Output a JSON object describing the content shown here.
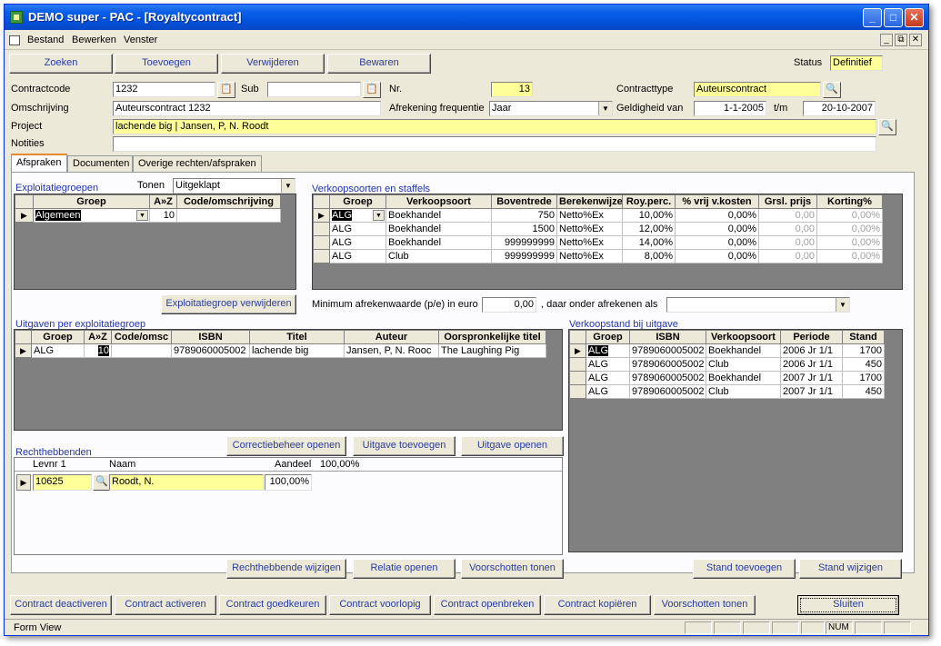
{
  "window": {
    "title": "DEMO super - PAC - [Royaltycontract]",
    "min": "_",
    "max": "□",
    "close": "✕"
  },
  "menu": {
    "items": [
      "Bestand",
      "Bewerken",
      "Venster"
    ],
    "mdi_min": "_",
    "mdi_restore": "⧉",
    "mdi_close": "✕"
  },
  "toolbar": {
    "buttons": [
      "Zoeken",
      "Toevoegen",
      "Verwijderen",
      "Bewaren"
    ],
    "status_label": "Status",
    "status_value": "Definitief"
  },
  "form": {
    "contractcode_label": "Contractcode",
    "contractcode_value": "1232",
    "sub_label": "Sub",
    "sub_value": "",
    "nr_label": "Nr.",
    "nr_value": "13",
    "contracttype_label": "Contracttype",
    "contracttype_value": "Auteurscontract",
    "omschrijving_label": "Omschrijving",
    "omschrijving_value": "Auteurscontract 1232",
    "afrekening_label": "Afrekening frequentie",
    "afrekening_value": "Jaar",
    "geldigheid_label": "Geldigheid van",
    "geldigheid_van": "1-1-2005",
    "tm_label": "t/m",
    "geldigheid_tm": "20-10-2007",
    "project_label": "Project",
    "project_value": "lachende big | Jansen, P, N. Roodt",
    "notities_label": "Notities",
    "notities_value": ""
  },
  "tabs": [
    "Afspraken",
    "Documenten",
    "Overige rechten/afspraken"
  ],
  "exploitatie": {
    "title": "Exploitatiegroepen",
    "tonen_label": "Tonen",
    "tonen_value": "Uitgeklapt",
    "columns": [
      "Groep",
      "A»Z",
      "Code/omschrijving"
    ],
    "rows": [
      [
        "Algemeen",
        "10",
        ""
      ]
    ],
    "remove_button": "Exploitatiegroep verwijderen"
  },
  "verkoop": {
    "title": "Verkoopsoorten en staffels",
    "columns": [
      "Groep",
      "Verkoopsoort",
      "Boventrede",
      "Berekenwijze",
      "Roy.perc.",
      "% vrij v.kosten",
      "Grsl. prijs",
      "Korting%"
    ],
    "rows": [
      [
        "ALG",
        "Boekhandel",
        "750",
        "Netto%Ex",
        "10,00%",
        "0,00%",
        "0,00",
        "0,00%"
      ],
      [
        "ALG",
        "Boekhandel",
        "1500",
        "Netto%Ex",
        "12,00%",
        "0,00%",
        "0,00",
        "0,00%"
      ],
      [
        "ALG",
        "Boekhandel",
        "999999999",
        "Netto%Ex",
        "14,00%",
        "0,00%",
        "0,00",
        "0,00%"
      ],
      [
        "ALG",
        "Club",
        "999999999",
        "Netto%Ex",
        "8,00%",
        "0,00%",
        "0,00",
        "0,00%"
      ]
    ],
    "min_label": "Minimum afrekenwaarde (p/e) in euro",
    "min_value": "0,00",
    "daar_label": ", daar onder afrekenen als",
    "daar_value": ""
  },
  "uitgaven": {
    "title": "Uitgaven per exploitatiegroep",
    "columns": [
      "Groep",
      "A»Z",
      "Code/omsc",
      "ISBN",
      "Titel",
      "Auteur",
      "Oorspronkelijke titel"
    ],
    "rows": [
      [
        "ALG",
        "10",
        "",
        "9789060005002",
        "lachende big",
        "Jansen, P, N. Rooc",
        "The Laughing Pig"
      ]
    ],
    "buttons": [
      "Correctiebeheer openen",
      "Uitgave toevoegen",
      "Uitgave openen"
    ]
  },
  "verkoopstand": {
    "title": "Verkoopstand bij uitgave",
    "columns": [
      "Groep",
      "ISBN",
      "Verkoopsoort",
      "Periode",
      "Stand"
    ],
    "rows": [
      [
        "ALG",
        "9789060005002",
        "Boekhandel",
        "2006 Jr 1/1",
        "1700"
      ],
      [
        "ALG",
        "9789060005002",
        "Club",
        "2006 Jr 1/1",
        "450"
      ],
      [
        "ALG",
        "9789060005002",
        "Boekhandel",
        "2007 Jr 1/1",
        "1700"
      ],
      [
        "ALG",
        "9789060005002",
        "Club",
        "2007 Jr 1/1",
        "450"
      ]
    ],
    "buttons": [
      "Stand toevoegen",
      "Stand wijzigen"
    ]
  },
  "rechthebbenden": {
    "title": "Rechthebbenden",
    "col_levnr": "Levnr 1",
    "col_naam": "Naam",
    "col_aandeel": "Aandeel",
    "aandeel_total": "100,00%",
    "levnr": "10625",
    "naam": "Roodt, N.",
    "aandeel": "100,00%",
    "buttons": [
      "Rechthebbende wijzigen",
      "Relatie openen",
      "Voorschotten tonen"
    ]
  },
  "footer_buttons": [
    "Contract deactiveren",
    "Contract activeren",
    "Contract goedkeuren",
    "Contract voorlopig",
    "Contract openbreken",
    "Contract kopiëren",
    "Voorschotten tonen",
    "Sluiten"
  ],
  "statusbar": {
    "mode": "Form View",
    "num": "NUM"
  }
}
